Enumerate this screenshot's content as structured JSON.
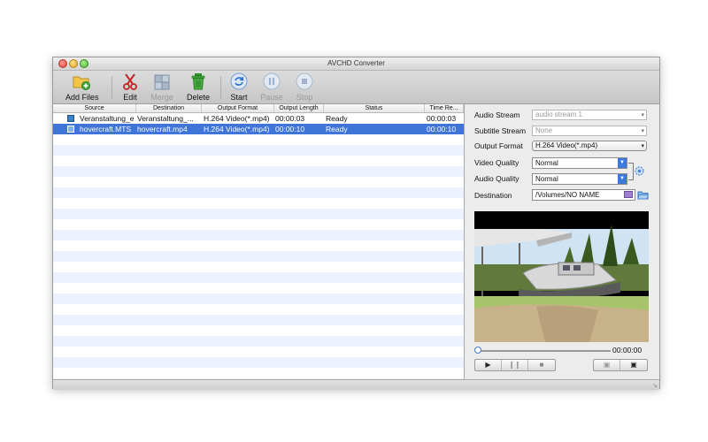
{
  "window": {
    "title": "AVCHD Converter"
  },
  "toolbar": {
    "add_files": "Add Files",
    "edit": "Edit",
    "merge": "Merge",
    "delete": "Delete",
    "start": "Start",
    "pause": "Pause",
    "stop": "Stop"
  },
  "table": {
    "columns": [
      "Source",
      "Destination",
      "Output Format",
      "Output Length",
      "Status",
      "Time Re..."
    ],
    "rows": [
      {
        "source": "Veranstaltung_e",
        "destination": "Veranstaltung_...",
        "format": "H.264 Video(*.mp4)",
        "length": "00:00:03",
        "status": "Ready",
        "time": "00:00:03"
      },
      {
        "source": "hovercraft.MTS",
        "destination": "hovercraft.mp4",
        "format": "H.264 Video(*.mp4)",
        "length": "00:00:10",
        "status": "Ready",
        "time": "00:00:10"
      }
    ]
  },
  "panel": {
    "audio_stream_label": "Audio Stream",
    "audio_stream_value": "audio stream 1",
    "subtitle_stream_label": "Subtitle Stream",
    "subtitle_stream_value": "None",
    "output_format_label": "Output Format",
    "output_format_value": "H.264 Video(*.mp4)",
    "video_quality_label": "Video Quality",
    "video_quality_value": "Normal",
    "audio_quality_label": "Audio Quality",
    "audio_quality_value": "Normal",
    "destination_label": "Destination",
    "destination_value": "/Volumes/NO NAME",
    "time": "00:00:00"
  },
  "colors": {
    "selection": "#3f74d8",
    "accent": "#3b79e0"
  }
}
